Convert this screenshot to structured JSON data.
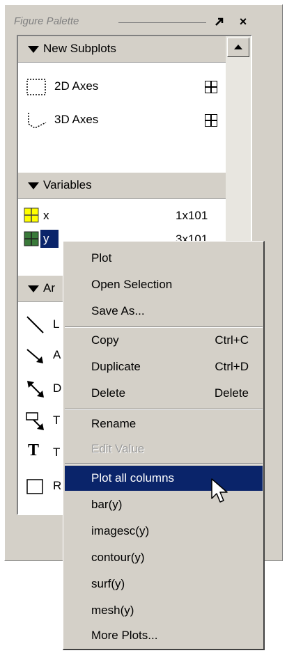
{
  "palette": {
    "title": "Figure Palette",
    "pin_icon": "pin-icon",
    "close_label": "×"
  },
  "new_subplots": {
    "header": "New Subplots",
    "items": [
      {
        "label": "2D Axes"
      },
      {
        "label": "3D Axes"
      }
    ]
  },
  "variables": {
    "header": "Variables",
    "items": [
      {
        "name": "x",
        "size": "1x101"
      },
      {
        "name": "y",
        "size": "3x101"
      }
    ]
  },
  "annotations": {
    "header_visible": "Ar",
    "items": [
      {
        "icon": "line-icon",
        "label_visible": "L"
      },
      {
        "icon": "arrow-icon",
        "label_visible": "A"
      },
      {
        "icon": "double-arrow-icon",
        "label_visible": "D"
      },
      {
        "icon": "text-arrow-icon",
        "label_visible": "T"
      },
      {
        "icon": "text-box-icon",
        "label_visible": "T"
      },
      {
        "icon": "rectangle-icon",
        "label_visible": "R"
      }
    ]
  },
  "context_menu": {
    "group1": [
      {
        "label": "Plot"
      },
      {
        "label": "Open Selection"
      },
      {
        "label": "Save As..."
      }
    ],
    "group2": [
      {
        "label": "Copy",
        "shortcut": "Ctrl+C"
      },
      {
        "label": "Duplicate",
        "shortcut": "Ctrl+D"
      },
      {
        "label": "Delete",
        "shortcut": "Delete"
      }
    ],
    "group3": [
      {
        "label": "Rename"
      },
      {
        "label": "Edit Value",
        "disabled": true
      }
    ],
    "group4": [
      {
        "label": "Plot all columns",
        "highlighted": true
      },
      {
        "label": "bar(y)"
      },
      {
        "label": "imagesc(y)"
      },
      {
        "label": "contour(y)"
      },
      {
        "label": "surf(y)"
      },
      {
        "label": "mesh(y)"
      },
      {
        "label": "More Plots..."
      }
    ]
  },
  "colors": {
    "highlight": "#0a246a",
    "face": "#d4d0c8",
    "var_x": "#ffff00",
    "var_y": "#3a7a3a"
  }
}
